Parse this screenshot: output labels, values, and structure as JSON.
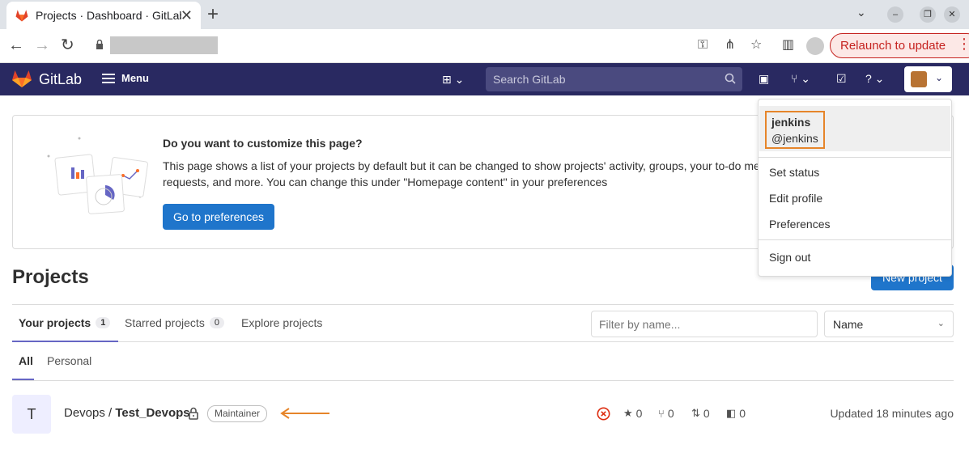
{
  "browser": {
    "tab_title": "Projects · Dashboard · GitLab",
    "new_tab": "+",
    "close": "✕",
    "relaunch_label": "Relaunch to update"
  },
  "header": {
    "brand": "GitLab",
    "menu_label": "Menu",
    "search_placeholder": "Search GitLab",
    "colors": {
      "bg": "#292961",
      "accent": "#1f75cb"
    }
  },
  "banner": {
    "title": "Do you want to customize this page?",
    "text": "This page shows a list of your projects by default but it can be changed to show projects' activity, groups, your to-do merge requests, and more. You can change this under \"Homepage content\" in your preferences",
    "button": "Go to preferences"
  },
  "projects": {
    "title": "Projects",
    "new_button": "New project",
    "tabs": [
      {
        "label": "Your projects",
        "count": "1"
      },
      {
        "label": "Starred projects",
        "count": "0"
      },
      {
        "label": "Explore projects"
      }
    ],
    "filter_placeholder": "Filter by name...",
    "sort_value": "Name",
    "subtabs": [
      "All",
      "Personal"
    ],
    "rows": [
      {
        "initial": "T",
        "namespace": "Devops / ",
        "name": "Test_Devops",
        "role": "Maintainer",
        "stars": "0",
        "forks": "0",
        "merge_requests": "0",
        "issues": "0",
        "updated": "Updated 18 minutes ago"
      }
    ]
  },
  "user_menu": {
    "username": "jenkins",
    "handle": "@jenkins",
    "items": [
      "Set status",
      "Edit profile",
      "Preferences"
    ],
    "sign_out": "Sign out"
  }
}
